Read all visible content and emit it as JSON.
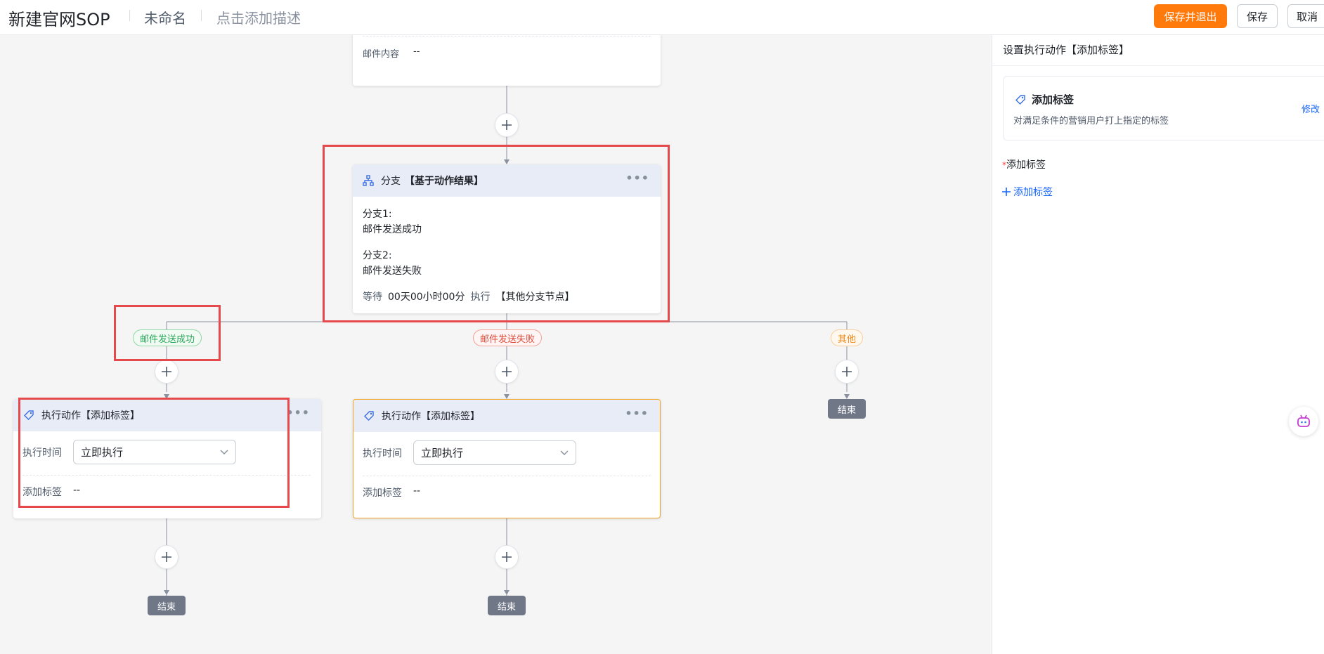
{
  "header": {
    "title": "新建官网SOP",
    "name": "未命名",
    "description_placeholder": "点击添加描述",
    "save_exit_label": "保存并退出",
    "save_label": "保存",
    "cancel_label": "取消"
  },
  "email_node": {
    "content_label": "邮件内容",
    "content_value": "--"
  },
  "branch_node": {
    "title": "分支",
    "subtitle": "【基于动作结果】",
    "branches": [
      {
        "name": "分支1:",
        "desc": "邮件发送成功"
      },
      {
        "name": "分支2:",
        "desc": "邮件发送失败"
      }
    ],
    "wait_label": "等待",
    "wait_value": "00天00小时00分",
    "exec_label": "执行",
    "exec_target": "【其他分支节点】"
  },
  "branch_pills": {
    "success": "邮件发送成功",
    "fail": "邮件发送失败",
    "other": "其他"
  },
  "action_nodes": [
    {
      "title": "执行动作【添加标签】",
      "time_label": "执行时间",
      "time_value": "立即执行",
      "tag_label": "添加标签",
      "tag_value": "--"
    },
    {
      "title": "执行动作【添加标签】",
      "time_label": "执行时间",
      "time_value": "立即执行",
      "tag_label": "添加标签",
      "tag_value": "--"
    }
  ],
  "end_label": "结束",
  "panel": {
    "title": "设置执行动作【添加标签】",
    "card_title": "添加标签",
    "card_desc": "对满足条件的营销用户打上指定的标签",
    "edit_label": "修改",
    "required_mark": "*",
    "field_label": "添加标签",
    "add_button_label": "添加标签"
  },
  "colors": {
    "primary": "#ff7a0b",
    "link": "#1664ff",
    "highlight": "#e5494b",
    "selected_border": "#f5a623",
    "end_button": "#707888"
  }
}
